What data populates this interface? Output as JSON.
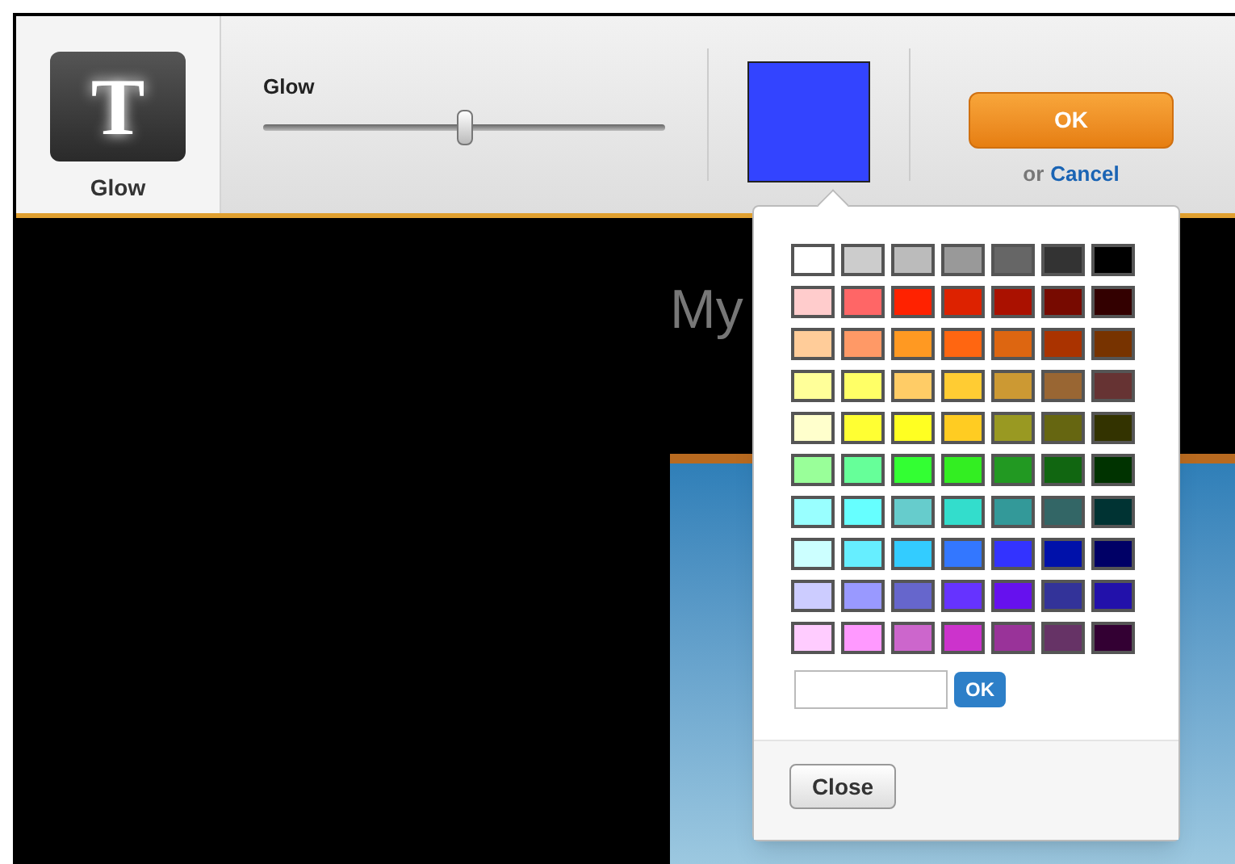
{
  "tool": {
    "icon_letter": "T",
    "label": "Glow"
  },
  "slider": {
    "label": "Glow",
    "level": 0.5
  },
  "current_color": {
    "color": "#3344ff"
  },
  "actions": {
    "ok": "OK",
    "or": "or",
    "cancel": "Cancel"
  },
  "canvas": {
    "title": "My"
  },
  "color_picker": {
    "swatches": [
      {
        "color": "#ffffff"
      },
      {
        "color": "#cccccc"
      },
      {
        "color": "#bbbbbb"
      },
      {
        "color": "#999999"
      },
      {
        "color": "#666666"
      },
      {
        "color": "#333333"
      },
      {
        "color": "#000000"
      },
      {
        "color": "#ffcccc"
      },
      {
        "color": "#ff6666"
      },
      {
        "color": "#ff2200"
      },
      {
        "color": "#dd2200"
      },
      {
        "color": "#aa1100"
      },
      {
        "color": "#770a00"
      },
      {
        "color": "#330000"
      },
      {
        "color": "#ffcc99"
      },
      {
        "color": "#ff9966"
      },
      {
        "color": "#ff9922"
      },
      {
        "color": "#ff6611"
      },
      {
        "color": "#dd6611"
      },
      {
        "color": "#aa3300"
      },
      {
        "color": "#773300"
      },
      {
        "color": "#ffff99"
      },
      {
        "color": "#ffff66"
      },
      {
        "color": "#ffcc66"
      },
      {
        "color": "#ffcc33"
      },
      {
        "color": "#cc9933"
      },
      {
        "color": "#996633"
      },
      {
        "color": "#663333"
      },
      {
        "color": "#ffffcc"
      },
      {
        "color": "#ffff33"
      },
      {
        "color": "#ffff22"
      },
      {
        "color": "#ffcc22"
      },
      {
        "color": "#999922"
      },
      {
        "color": "#666611"
      },
      {
        "color": "#333300"
      },
      {
        "color": "#99ff99"
      },
      {
        "color": "#66ff99"
      },
      {
        "color": "#33ff33"
      },
      {
        "color": "#33ee22"
      },
      {
        "color": "#229922"
      },
      {
        "color": "#116611"
      },
      {
        "color": "#003300"
      },
      {
        "color": "#99ffff"
      },
      {
        "color": "#66ffff"
      },
      {
        "color": "#66cccc"
      },
      {
        "color": "#33ddcc"
      },
      {
        "color": "#339999"
      },
      {
        "color": "#336666"
      },
      {
        "color": "#003333"
      },
      {
        "color": "#ccffff"
      },
      {
        "color": "#66eeff"
      },
      {
        "color": "#33ccff"
      },
      {
        "color": "#3377ff"
      },
      {
        "color": "#3333ff"
      },
      {
        "color": "#0011aa"
      },
      {
        "color": "#000066"
      },
      {
        "color": "#ccccff"
      },
      {
        "color": "#9999ff"
      },
      {
        "color": "#6666cc"
      },
      {
        "color": "#6633ff"
      },
      {
        "color": "#6611ee"
      },
      {
        "color": "#333399"
      },
      {
        "color": "#2211aa"
      },
      {
        "color": "#ffccff"
      },
      {
        "color": "#ff99ff"
      },
      {
        "color": "#cc66cc"
      },
      {
        "color": "#cc33cc"
      },
      {
        "color": "#993399"
      },
      {
        "color": "#663366"
      },
      {
        "color": "#330033"
      }
    ],
    "apply_button": "OK",
    "close_button": "Close"
  }
}
